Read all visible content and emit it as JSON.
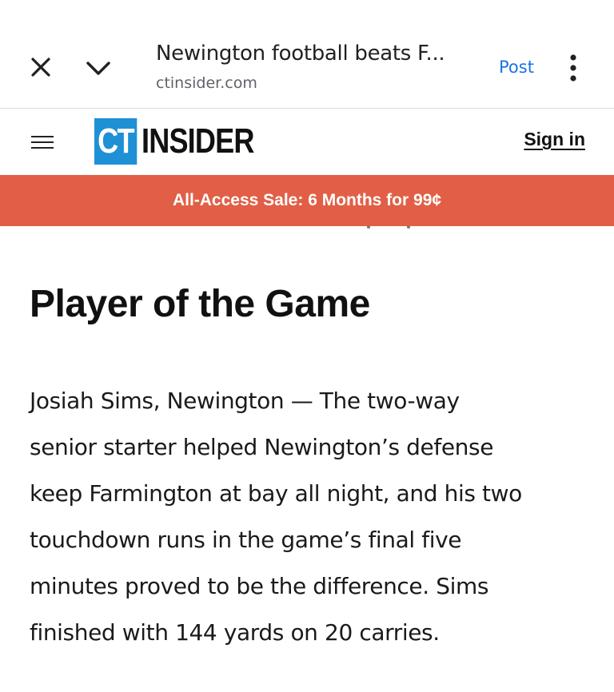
{
  "browser": {
    "title": "Newington football beats F...",
    "url": "ctinsider.com",
    "post_label": "Post",
    "icons": [
      "close-icon",
      "chevron-down-icon",
      "more-vert-icon"
    ]
  },
  "header": {
    "logo_ct": "CT",
    "logo_word": "INSIDER",
    "sign_in": "Sign in",
    "brand_color": "#1e90d6",
    "icons": [
      "menu-icon"
    ]
  },
  "promo": {
    "text": "All-Access Sale: 6 Months for 99¢",
    "color": "#e15f46"
  },
  "article": {
    "heading": "Player of the Game",
    "body_lines": [
      "Josiah Sims, Newington — The two-way",
      "senior starter helped Newington’s defense",
      "keep Farmington at bay all night, and his two",
      "touchdown runs in the game’s final five",
      "minutes proved to be the difference. Sims",
      "finished with 144 yards on 20 carries."
    ]
  }
}
